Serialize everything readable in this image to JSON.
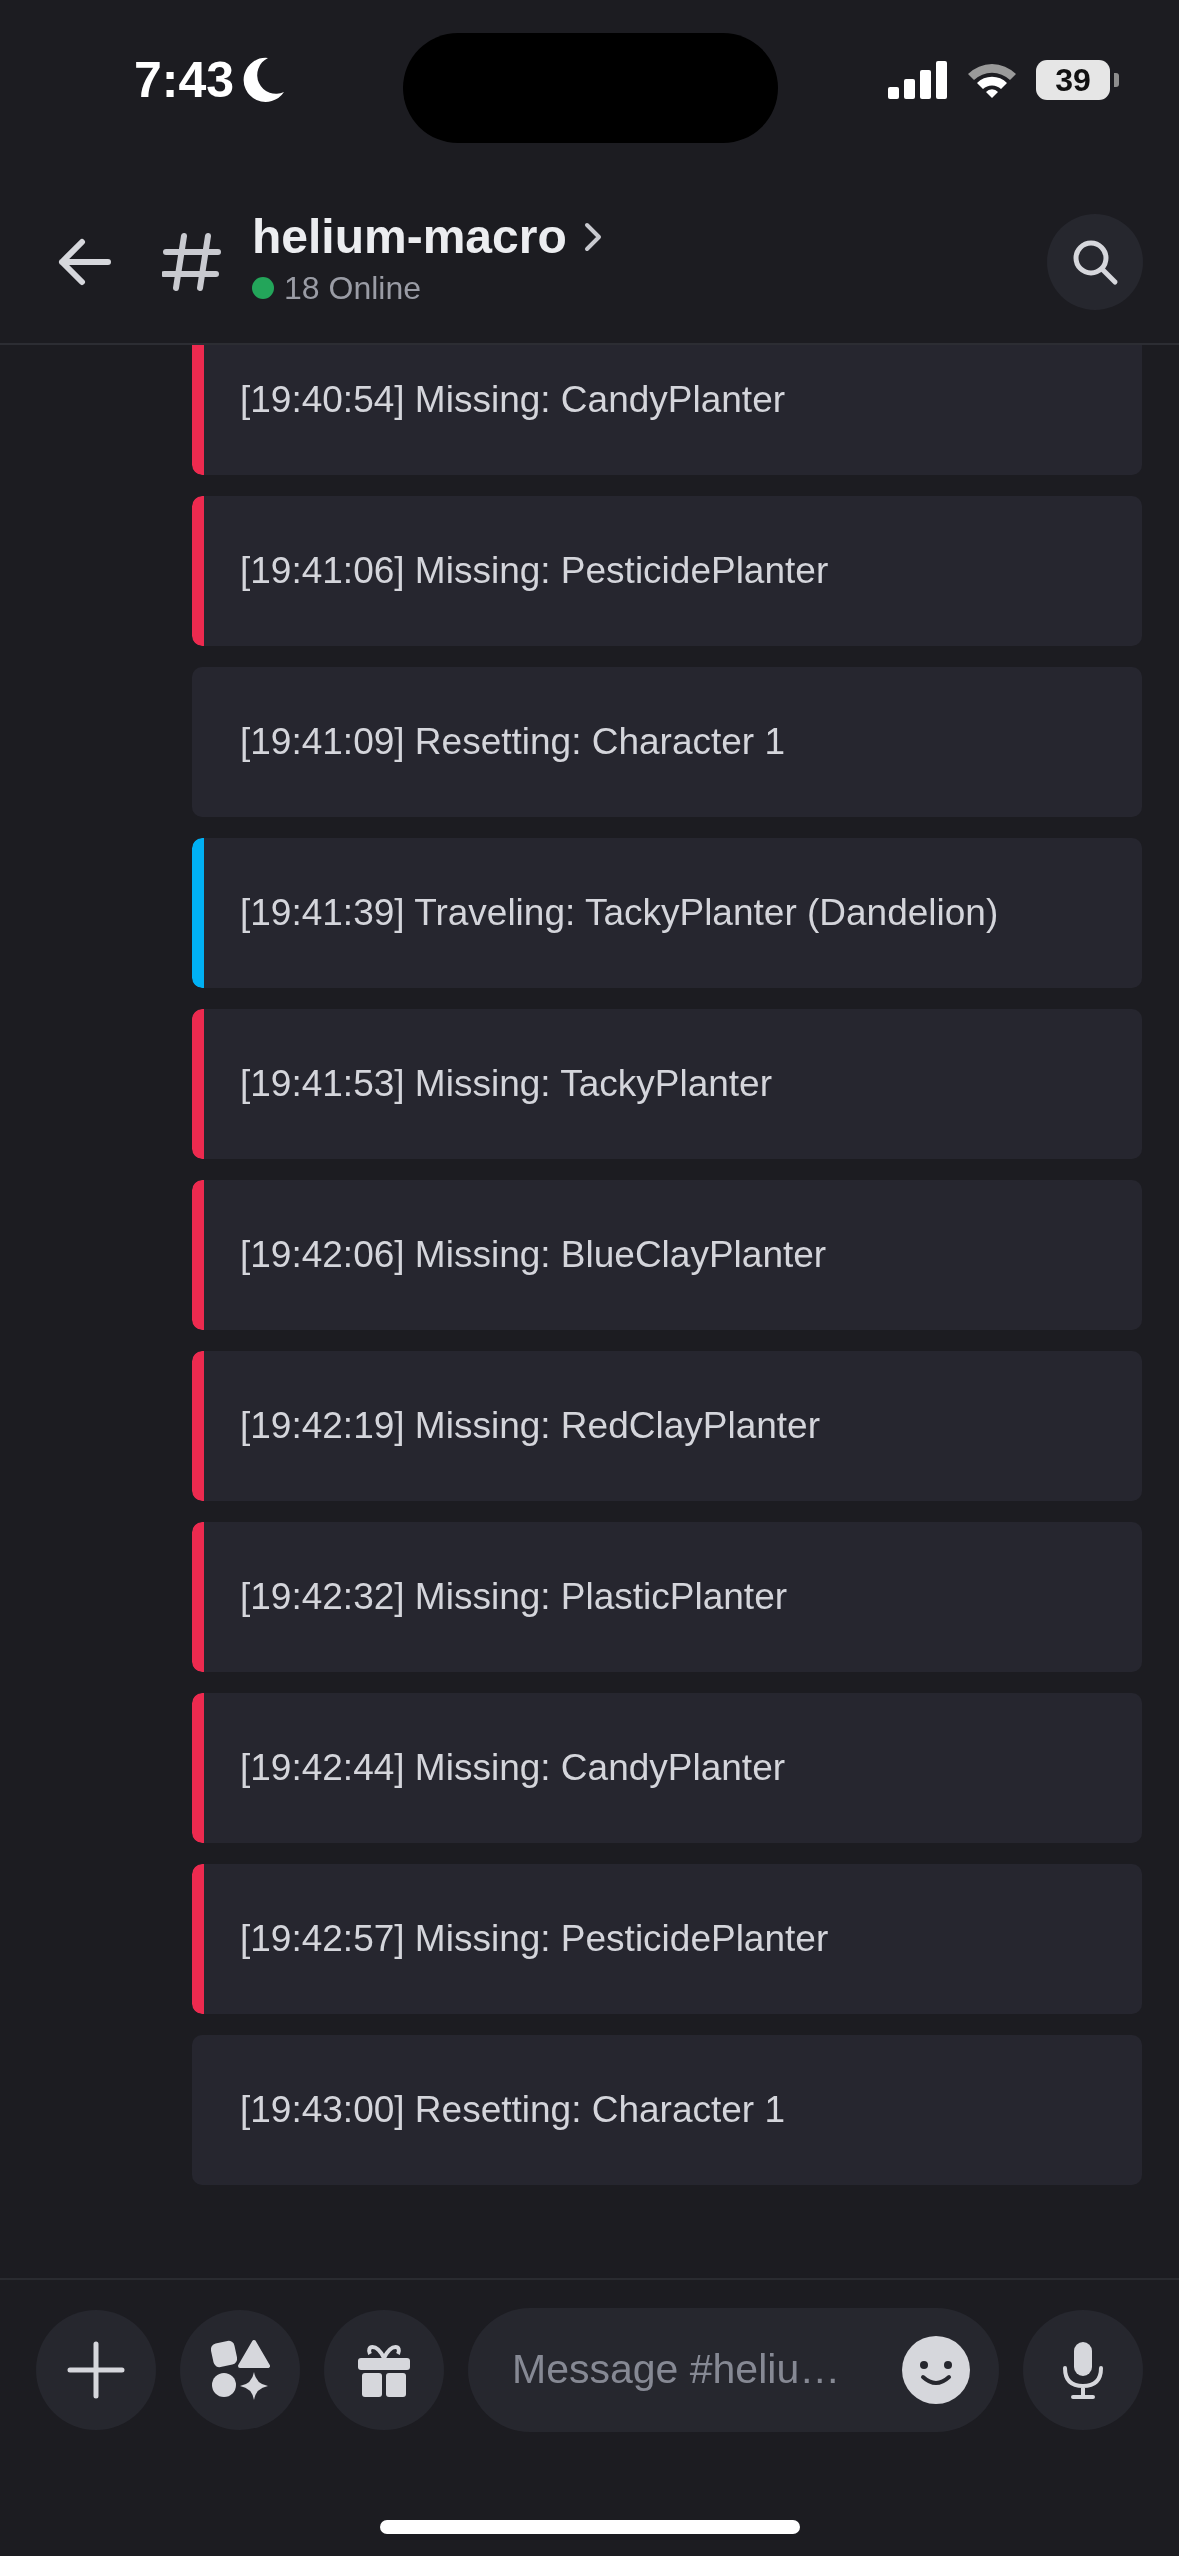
{
  "status_bar": {
    "time": "7:43",
    "battery": "39"
  },
  "header": {
    "channel": "helium-macro",
    "online": "18 Online"
  },
  "messages": [
    {
      "text": "[19:40:54] Missing: CandyPlanter",
      "color": "#ed2a4f"
    },
    {
      "text": "[19:41:06] Missing: PesticidePlanter",
      "color": "#ed2a4f"
    },
    {
      "text": "[19:41:09] Resetting: Character 1"
    },
    {
      "text": "[19:41:39] Traveling: TackyPlanter (Dandelion)",
      "color": "#00b0f4"
    },
    {
      "text": "[19:41:53] Missing: TackyPlanter",
      "color": "#ed2a4f"
    },
    {
      "text": "[19:42:06] Missing: BlueClayPlanter",
      "color": "#ed2a4f"
    },
    {
      "text": "[19:42:19] Missing: RedClayPlanter",
      "color": "#ed2a4f"
    },
    {
      "text": "[19:42:32] Missing: PlasticPlanter",
      "color": "#ed2a4f"
    },
    {
      "text": "[19:42:44] Missing: CandyPlanter",
      "color": "#ed2a4f"
    },
    {
      "text": "[19:42:57] Missing: PesticidePlanter",
      "color": "#ed2a4f"
    },
    {
      "text": "[19:43:00] Resetting: Character 1"
    }
  ],
  "composer": {
    "placeholder": "Message #heliu…"
  }
}
